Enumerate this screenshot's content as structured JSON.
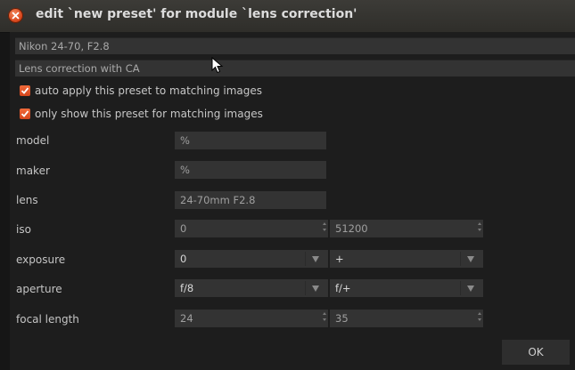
{
  "window": {
    "title": "edit `new preset' for module `lens correction'"
  },
  "preset": {
    "name": "Nikon 24-70, F2.8",
    "description": "Lens correction with CA"
  },
  "options": {
    "auto_apply": {
      "label": "auto apply this preset to matching images",
      "checked": true
    },
    "only_show": {
      "label": "only show this preset for matching images",
      "checked": true
    }
  },
  "filters": {
    "model": {
      "label": "model",
      "value": "%"
    },
    "maker": {
      "label": "maker",
      "value": "%"
    },
    "lens": {
      "label": "lens",
      "value": "24-70mm F2.8"
    },
    "iso": {
      "label": "iso",
      "min": "0",
      "max": "51200"
    },
    "exposure": {
      "label": "exposure",
      "min": "0",
      "max": "+"
    },
    "aperture": {
      "label": "aperture",
      "min": "f/8",
      "max": "f/+"
    },
    "focal_length": {
      "label": "focal length",
      "min": "24",
      "max": "35"
    }
  },
  "buttons": {
    "ok": "OK"
  },
  "colors": {
    "accent": "#e35a2a",
    "background": "#1d1d1d",
    "field": "#333333"
  }
}
